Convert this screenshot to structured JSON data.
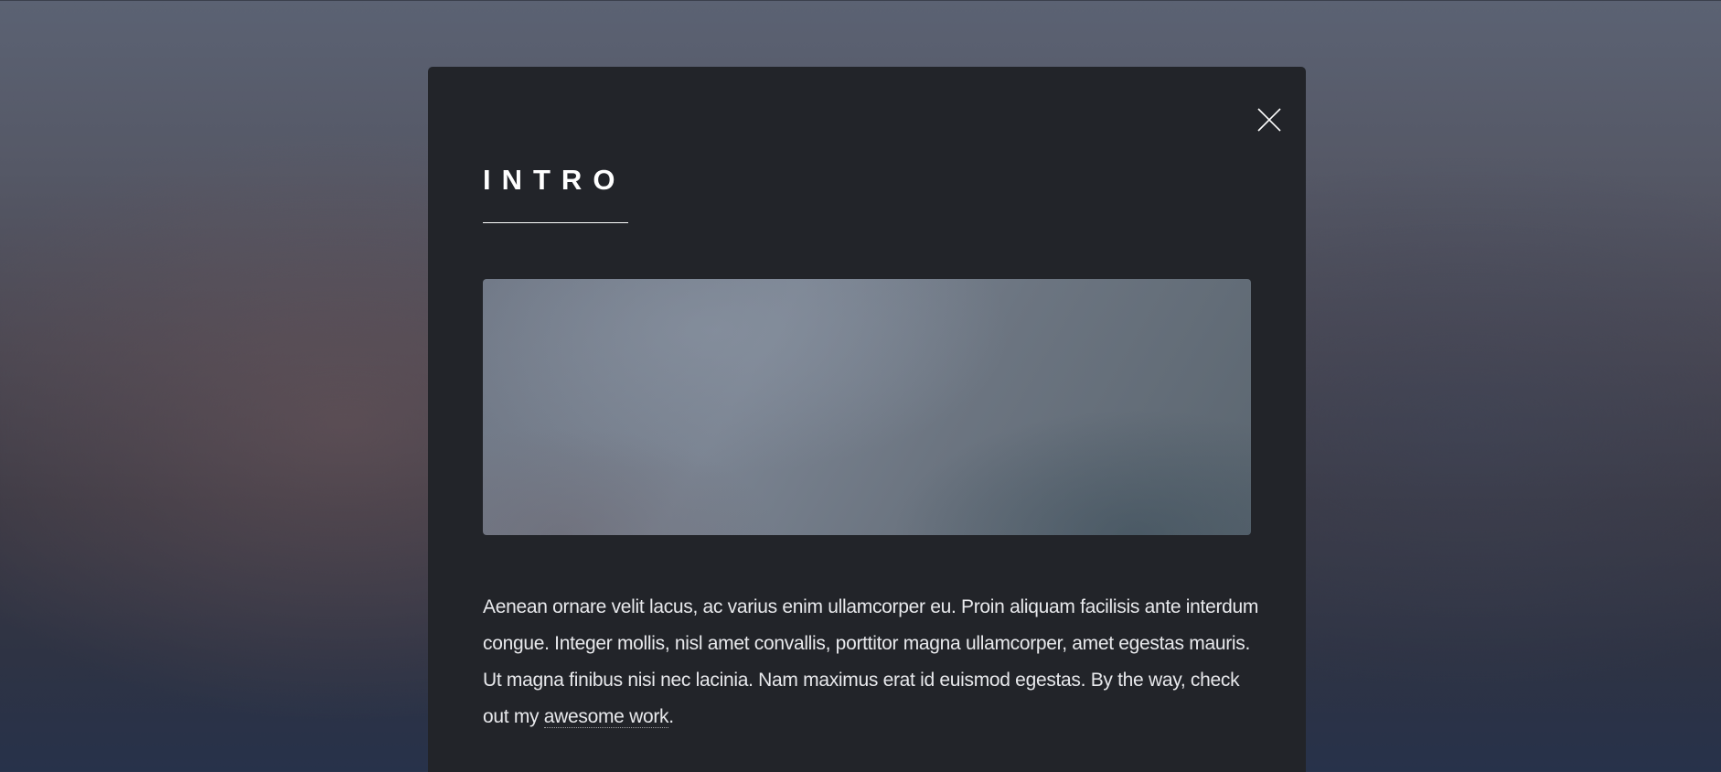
{
  "modal": {
    "title": "INTRO",
    "close_icon": "close-icon",
    "image": {
      "description_colors": [
        "#7b8492",
        "#5b6670"
      ]
    },
    "paragraph": {
      "text_before_link": "Aenean ornare velit lacus, ac varius enim ullamcorper eu. Proin aliquam facilisis ante interdum congue. Integer mollis, nisl amet convallis, porttitor magna ullamcorper, amet egestas mauris. Ut magna finibus nisi nec lacinia. Nam maximus erat id euismod egestas. By the way, check out my ",
      "link_text": "awesome work",
      "text_after_link": "."
    }
  },
  "colors": {
    "modal_background": "#222429",
    "text": "#e8e9ec",
    "title": "#ffffff"
  }
}
